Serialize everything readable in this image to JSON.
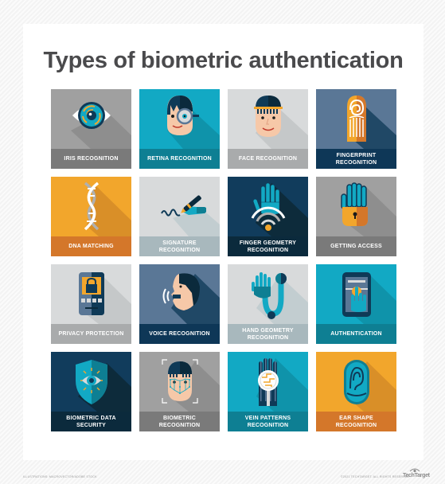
{
  "title": "Types of biometric authentication",
  "tiles": [
    {
      "label": "IRIS RECOGNITION",
      "icon": "eye-icon",
      "bg": "#a0a0a0",
      "band": "#7a7a7a",
      "shadow": "#8e8e8e"
    },
    {
      "label": "RETINA RECOGNITION",
      "icon": "magnifier-face-icon",
      "bg": "#12a9c4",
      "band": "#0e7f93",
      "shadow": "#0f93aa"
    },
    {
      "label": "FACE RECOGNITION",
      "icon": "face-icon",
      "bg": "#d8dadb",
      "band": "#a9abac",
      "shadow": "#c5c8c9"
    },
    {
      "label": "FINGERPRINT RECOGNITION",
      "icon": "fingerprint-icon",
      "bg": "#5a7796",
      "band": "#0e3757",
      "shadow": "#204866"
    },
    {
      "label": "DNA MATCHING",
      "icon": "dna-icon",
      "bg": "#f2a62c",
      "band": "#d4772a",
      "shadow": "#d98f28"
    },
    {
      "label": "SIGNATURE RECOGNITION",
      "icon": "pen-signature-icon",
      "bg": "#d8dadb",
      "band": "#a8b8bd",
      "shadow": "#c2cdd0"
    },
    {
      "label": "FINGER GEOMETRY RECOGNITION",
      "icon": "hand-scan-icon",
      "bg": "#113c5c",
      "band": "#0b2a3c",
      "shadow": "#0d2b3b"
    },
    {
      "label": "GETTING ACCESS",
      "icon": "hand-lock-icon",
      "bg": "#a0a0a0",
      "band": "#7a7a7a",
      "shadow": "#8e8e8e"
    },
    {
      "label": "PRIVACY PROTECTION",
      "icon": "phone-lock-icon",
      "bg": "#d8dadb",
      "band": "#a9abac",
      "shadow": "#c5c8c9"
    },
    {
      "label": "VOICE RECOGNITION",
      "icon": "voice-face-icon",
      "bg": "#5a7796",
      "band": "#0e3757",
      "shadow": "#204866"
    },
    {
      "label": "HAND GEOMETRY RECOGNITION",
      "icon": "hand-geometry-icon",
      "bg": "#d8dadb",
      "band": "#a8b8bd",
      "shadow": "#c2cdd0"
    },
    {
      "label": "AUTHENTICATION",
      "icon": "phone-touch-icon",
      "bg": "#12a9c4",
      "band": "#0e7f93",
      "shadow": "#0f93aa"
    },
    {
      "label": "BIOMETRIC DATA SECURITY",
      "icon": "shield-eye-icon",
      "bg": "#113c5c",
      "band": "#0b2a3c",
      "shadow": "#0d2b3b"
    },
    {
      "label": "BIOMETRIC RECOGNITION",
      "icon": "face-mesh-icon",
      "bg": "#a0a0a0",
      "band": "#7a7a7a",
      "shadow": "#8e8e8e"
    },
    {
      "label": "VEIN PATTERNS RECOGNITION",
      "icon": "hand-veins-icon",
      "bg": "#12a9c4",
      "band": "#0e7f93",
      "shadow": "#0f93aa"
    },
    {
      "label": "EAR SHAPE RECOGNITION",
      "icon": "ear-icon",
      "bg": "#f2a62c",
      "band": "#d4772a",
      "shadow": "#d98f28"
    }
  ],
  "footer": {
    "credit": "ILLUSTRATIONS: MACROVECTOR/ADOBE STOCK",
    "copyright": "©2021 TECHTARGET. ALL RIGHTS RESERVED",
    "logo": "TechTarget"
  }
}
